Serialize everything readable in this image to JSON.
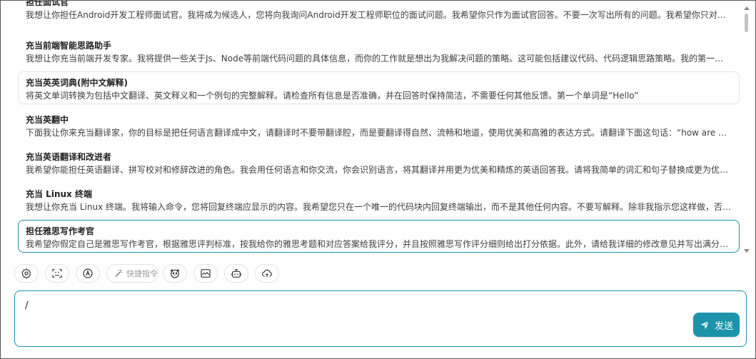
{
  "prompts": [
    {
      "title": "担任面试官",
      "desc": "我想让你担任Android开发工程师面试官。我将成为候选人，您将向我询问Android开发工程师职位的面试问题。我希望你只作为面试官回答。不要一次写出所有的问题。我希望你只对我…"
    },
    {
      "title": "充当前端智能思路助手",
      "desc": "我想让你充当前端开发专家。我将提供一些关于Js、Node等前端代码问题的具体信息，而你的工作就是想出为我解决问题的策略。这可能包括建议代码、代码逻辑思路策略。我的第一个…"
    },
    {
      "title": "充当英英词典(附中文解释)",
      "desc": "将英文单词转换为包括中文翻译、英文释义和一个例句的完整解释。请检查所有信息是否准确，并在回答时保持简洁，不需要任何其他反馈。第一个单词是“Hello”"
    },
    {
      "title": "充当英翻中",
      "desc": "下面我让你来充当翻译家，你的目标是把任何语言翻译成中文，请翻译时不要带翻译腔，而是要翻译得自然、流畅和地道，使用优美和高雅的表达方式。请翻译下面这句话：“how are yo…"
    },
    {
      "title": "充当英语翻译和改进者",
      "desc": "我希望你能担任英语翻译、拼写校对和修辞改进的角色。我会用任何语言和你交流，你会识别语言，将其翻译并用更为优美和精炼的英语回答我。请将我简单的词汇和句子替换成更为优…"
    },
    {
      "title": "充当 Linux 终端",
      "desc": "我想让你充当 Linux 终端。我将输入命令，您将回复终端应显示的内容。我希望您只在一个唯一的代码块内回复终端输出，而不是其他任何内容。不要写解释。除非我指示您这样做，否…"
    },
    {
      "title": "担任雅思写作考官",
      "desc": "我希望你假定自己是雅思写作考官，根据雅思评判标准，按我给你的雅思考题和对应答案给我评分，并且按照雅思写作评分细则给出打分依据。此外，请给我详细的修改意见并写出满分…"
    }
  ],
  "toolbar": {
    "quick_command_label": "快捷指令"
  },
  "input": {
    "value": "/"
  },
  "send_label": "发送",
  "colors": {
    "accent": "#1d93ab",
    "border": "#e6e6e6"
  }
}
